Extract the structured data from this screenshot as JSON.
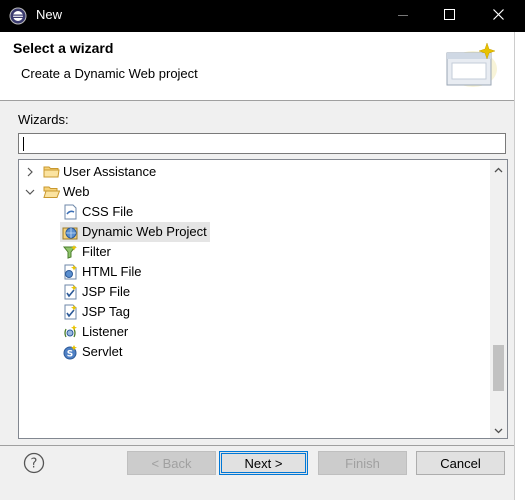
{
  "window": {
    "title": "New",
    "minimize_icon": "minimize-icon",
    "maximize_icon": "maximize-icon",
    "close_icon": "close-icon"
  },
  "header": {
    "title": "Select a wizard",
    "description": "Create a Dynamic Web project"
  },
  "wizards": {
    "label": "Wizards:",
    "filter_value": "",
    "tree": [
      {
        "label": "User Assistance",
        "expanded": false,
        "level": 0,
        "icon": "folder-icon"
      },
      {
        "label": "Web",
        "expanded": true,
        "level": 0,
        "icon": "folder-open-icon"
      },
      {
        "label": "CSS File",
        "level": 1,
        "icon": "css-file-icon"
      },
      {
        "label": "Dynamic Web Project",
        "level": 1,
        "icon": "web-project-icon",
        "selected": true
      },
      {
        "label": "Filter",
        "level": 1,
        "icon": "filter-icon"
      },
      {
        "label": "HTML File",
        "level": 1,
        "icon": "html-file-icon"
      },
      {
        "label": "JSP File",
        "level": 1,
        "icon": "jsp-file-icon"
      },
      {
        "label": "JSP Tag",
        "level": 1,
        "icon": "jsp-tag-icon"
      },
      {
        "label": "Listener",
        "level": 1,
        "icon": "listener-icon"
      },
      {
        "label": "Servlet",
        "level": 1,
        "icon": "servlet-icon"
      }
    ],
    "scroll_position": 0.85
  },
  "buttons": {
    "back": "< Back",
    "next": "Next >",
    "finish": "Finish",
    "cancel": "Cancel"
  },
  "colors": {
    "titlebar": "#000000",
    "selection": "#e5e5e5",
    "default_button_border": "#0078d7"
  }
}
